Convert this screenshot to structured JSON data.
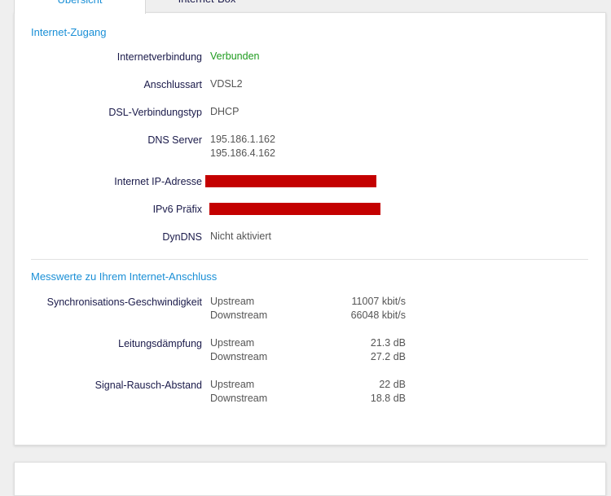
{
  "tabs": [
    {
      "label": "Übersicht",
      "active": true
    },
    {
      "label": "Internet-Box",
      "active": false
    }
  ],
  "colors": {
    "accent": "#1a8fd6",
    "connected": "#1e9b1e",
    "redaction": "#c40000"
  },
  "internet_access": {
    "title": "Internet-Zugang",
    "rows": [
      {
        "label": "Internetverbindung",
        "value": "Verbunden"
      },
      {
        "label": "Anschlussart",
        "value": "VDSL2"
      },
      {
        "label": "DSL-Verbindungstyp",
        "value": "DHCP"
      },
      {
        "label": "DNS Server",
        "values": [
          "195.186.1.162",
          "195.186.4.162"
        ]
      },
      {
        "label": "Internet IP-Adresse",
        "value": ""
      },
      {
        "label": "IPv6 Präfix",
        "value": ""
      },
      {
        "label": "DynDNS",
        "value": "Nicht aktiviert"
      }
    ]
  },
  "measurements": {
    "title": "Messwerte zu Ihrem Internet-Anschluss",
    "rows": [
      {
        "label": "Synchronisations-Geschwindigkeit",
        "items": [
          {
            "key": "Upstream",
            "value": "11007 kbit/s"
          },
          {
            "key": "Downstream",
            "value": "66048 kbit/s"
          }
        ]
      },
      {
        "label": "Leitungsdämpfung",
        "items": [
          {
            "key": "Upstream",
            "value": "21.3 dB"
          },
          {
            "key": "Downstream",
            "value": "27.2 dB"
          }
        ]
      },
      {
        "label": "Signal-Rausch-Abstand",
        "items": [
          {
            "key": "Upstream",
            "value": "22 dB"
          },
          {
            "key": "Downstream",
            "value": "18.8 dB"
          }
        ]
      }
    ]
  }
}
